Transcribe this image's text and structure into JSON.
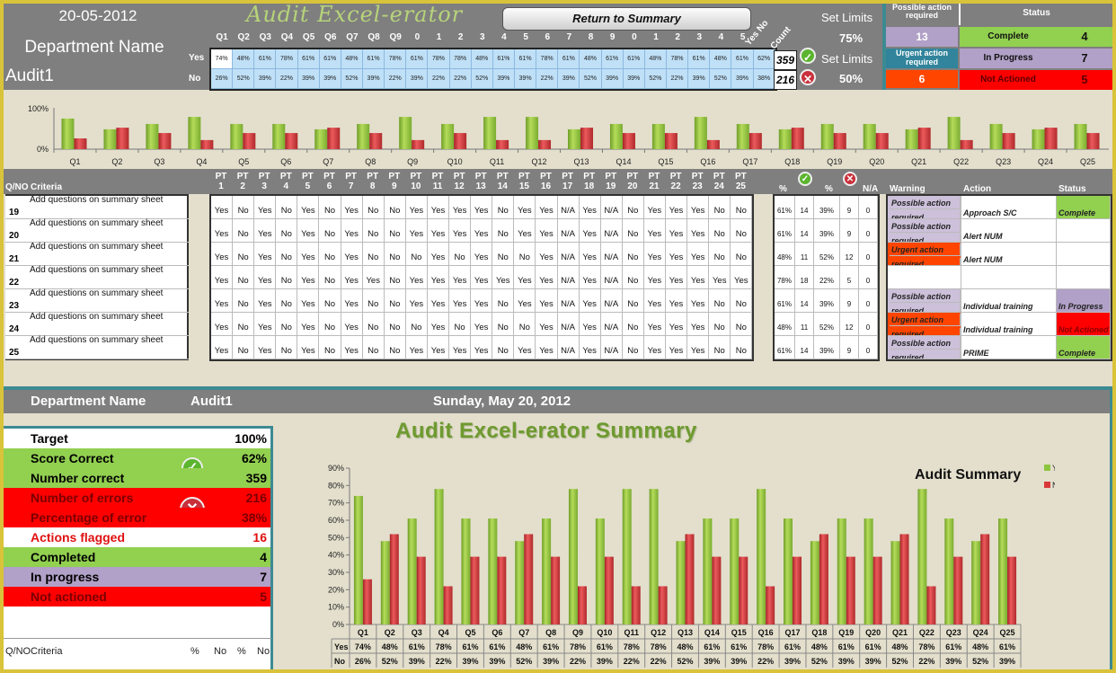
{
  "header": {
    "date": "20-05-2012",
    "department_label": "Department Name",
    "audit_name": "Audit1",
    "app_title": "Audit Excel-erator",
    "return_button": "Return to Summary",
    "row_labels": [
      "Yes",
      "No"
    ],
    "question_headers": [
      "Q1",
      "Q2",
      "Q3",
      "Q4",
      "Q5",
      "Q6",
      "Q7",
      "Q8",
      "Q9",
      "0",
      "1",
      "2",
      "3",
      "4",
      "5",
      "6",
      "7",
      "8",
      "9",
      "0",
      "1",
      "2",
      "3",
      "4",
      "5"
    ],
    "yes_no_header": "Yes No",
    "count_header": "Count",
    "yes_pcts": [
      "74%",
      "48%",
      "61%",
      "78%",
      "61%",
      "61%",
      "48%",
      "61%",
      "78%",
      "61%",
      "78%",
      "78%",
      "48%",
      "61%",
      "61%",
      "78%",
      "61%",
      "48%",
      "61%",
      "61%",
      "48%",
      "78%",
      "61%",
      "48%",
      "61%",
      "62%"
    ],
    "no_pcts": [
      "26%",
      "52%",
      "39%",
      "22%",
      "39%",
      "39%",
      "52%",
      "39%",
      "22%",
      "39%",
      "22%",
      "22%",
      "52%",
      "39%",
      "39%",
      "22%",
      "39%",
      "52%",
      "39%",
      "39%",
      "52%",
      "22%",
      "39%",
      "52%",
      "39%",
      "38%"
    ],
    "count_yes": "359",
    "count_no": "216",
    "set_limits_label": "Set Limits",
    "limit_upper": "75%",
    "limit_lower": "50%",
    "possible_action_header": "Possible action required",
    "possible_action_count": "13",
    "urgent_action_header": "Urgent action required",
    "urgent_action_count": "6",
    "status_header": "Status",
    "status": [
      {
        "label": "Complete",
        "count": "4",
        "color": "#92d050"
      },
      {
        "label": "In Progress",
        "count": "7",
        "color": "#b1a0c7"
      },
      {
        "label": "Not Actioned",
        "count": "5",
        "color": "#ff0000"
      }
    ]
  },
  "mini_chart": {
    "y_ticks": [
      "100%",
      "0%"
    ]
  },
  "detail": {
    "qno_header": "Q/NO",
    "criteria_header": "Criteria",
    "pt_headers": [
      "PT 1",
      "PT 2",
      "PT 3",
      "PT 4",
      "PT 5",
      "PT 6",
      "PT 7",
      "PT 8",
      "PT 9",
      "PT 10",
      "PT 11",
      "PT 12",
      "PT 13",
      "PT 14",
      "PT 15",
      "PT 16",
      "PT 17",
      "PT 18",
      "PT 19",
      "PT 20",
      "PT 21",
      "PT 22",
      "PT 23",
      "PT 24",
      "PT 25"
    ],
    "stat_headers": [
      "%",
      "check-icon",
      "%",
      "cross-icon",
      "N/A"
    ],
    "action_headers": [
      "Warning",
      "Action",
      "Status"
    ],
    "rows": [
      {
        "num": "19",
        "criteria": "Add  questions on summary sheet",
        "answers": [
          "Yes",
          "No",
          "Yes",
          "No",
          "Yes",
          "No",
          "Yes",
          "No",
          "No",
          "Yes",
          "Yes",
          "Yes",
          "Yes",
          "No",
          "Yes",
          "Yes",
          "N/A",
          "Yes",
          "N/A",
          "No",
          "Yes",
          "Yes",
          "Yes",
          "No",
          "No"
        ],
        "stats": [
          "61%",
          "14",
          "39%",
          "9",
          "0"
        ],
        "warning": "Possible action required",
        "warning_type": "possible",
        "action": "Approach S/C",
        "status": "Complete"
      },
      {
        "num": "20",
        "criteria": "Add  questions on summary sheet",
        "answers": [
          "Yes",
          "No",
          "Yes",
          "No",
          "Yes",
          "No",
          "Yes",
          "No",
          "No",
          "Yes",
          "Yes",
          "Yes",
          "Yes",
          "No",
          "Yes",
          "Yes",
          "N/A",
          "Yes",
          "N/A",
          "No",
          "Yes",
          "Yes",
          "Yes",
          "No",
          "No"
        ],
        "stats": [
          "61%",
          "14",
          "39%",
          "9",
          "0"
        ],
        "warning": "Possible action required",
        "warning_type": "possible",
        "action": "Alert NUM",
        "status": ""
      },
      {
        "num": "21",
        "criteria": "Add  questions on summary sheet",
        "answers": [
          "Yes",
          "No",
          "Yes",
          "No",
          "Yes",
          "No",
          "Yes",
          "No",
          "No",
          "No",
          "Yes",
          "No",
          "Yes",
          "No",
          "No",
          "Yes",
          "N/A",
          "Yes",
          "N/A",
          "No",
          "Yes",
          "Yes",
          "Yes",
          "No",
          "No"
        ],
        "stats": [
          "48%",
          "11",
          "52%",
          "12",
          "0"
        ],
        "warning": "Urgent action required",
        "warning_type": "urgent",
        "action": "Alert NUM",
        "status": ""
      },
      {
        "num": "22",
        "criteria": "Add  questions on summary sheet",
        "answers": [
          "Yes",
          "No",
          "Yes",
          "No",
          "Yes",
          "No",
          "Yes",
          "Yes",
          "No",
          "Yes",
          "Yes",
          "Yes",
          "Yes",
          "Yes",
          "Yes",
          "Yes",
          "N/A",
          "Yes",
          "N/A",
          "No",
          "Yes",
          "Yes",
          "Yes",
          "Yes",
          "Yes"
        ],
        "stats": [
          "78%",
          "18",
          "22%",
          "5",
          "0"
        ],
        "warning": "",
        "warning_type": "none",
        "action": "",
        "status": ""
      },
      {
        "num": "23",
        "criteria": "Add  questions on summary sheet",
        "answers": [
          "Yes",
          "No",
          "Yes",
          "No",
          "Yes",
          "No",
          "Yes",
          "No",
          "No",
          "Yes",
          "Yes",
          "Yes",
          "Yes",
          "No",
          "Yes",
          "Yes",
          "N/A",
          "Yes",
          "N/A",
          "No",
          "Yes",
          "Yes",
          "Yes",
          "No",
          "No"
        ],
        "stats": [
          "61%",
          "14",
          "39%",
          "9",
          "0"
        ],
        "warning": "Possible action required",
        "warning_type": "possible",
        "action": "Individual training",
        "status": "In Progress"
      },
      {
        "num": "24",
        "criteria": "Add  questions on summary sheet",
        "answers": [
          "Yes",
          "No",
          "Yes",
          "No",
          "Yes",
          "No",
          "Yes",
          "No",
          "No",
          "No",
          "Yes",
          "No",
          "Yes",
          "No",
          "No",
          "Yes",
          "N/A",
          "Yes",
          "N/A",
          "No",
          "Yes",
          "Yes",
          "Yes",
          "No",
          "No"
        ],
        "stats": [
          "48%",
          "11",
          "52%",
          "12",
          "0"
        ],
        "warning": "Urgent action required",
        "warning_type": "urgent",
        "action": "Individual training",
        "status": "Not Actioned"
      },
      {
        "num": "25",
        "criteria": "Add  questions on summary sheet",
        "answers": [
          "Yes",
          "No",
          "Yes",
          "No",
          "Yes",
          "No",
          "Yes",
          "No",
          "No",
          "Yes",
          "Yes",
          "Yes",
          "Yes",
          "No",
          "Yes",
          "Yes",
          "N/A",
          "Yes",
          "N/A",
          "No",
          "Yes",
          "Yes",
          "Yes",
          "No",
          "No"
        ],
        "stats": [
          "61%",
          "14",
          "39%",
          "9",
          "0"
        ],
        "warning": "Possible action required",
        "warning_type": "possible",
        "action": "PRIME",
        "status": "Complete"
      }
    ]
  },
  "summary": {
    "department_label": "Department Name",
    "audit_name": "Audit1",
    "date_long": "Sunday, May 20, 2012",
    "title": "Audit Excel-erator Summary",
    "kpis": [
      {
        "label": "Target",
        "value": "100%",
        "bg": "#ffffff",
        "fg": "#000000"
      },
      {
        "label": "Score Correct",
        "value": "62%",
        "bg": "#92d050",
        "fg": "#000000"
      },
      {
        "label": "Number correct",
        "value": "359",
        "bg": "#92d050",
        "fg": "#000000"
      },
      {
        "label": "Number of errors",
        "value": "216",
        "bg": "#ff0000",
        "fg": "#7a0000"
      },
      {
        "label": "Percentage of error",
        "value": "38%",
        "bg": "#ff0000",
        "fg": "#7a0000"
      },
      {
        "label": "Actions flagged",
        "value": "16",
        "bg": "#ffffff",
        "fg": "#e01010"
      },
      {
        "label": "Completed",
        "value": "4",
        "bg": "#92d050",
        "fg": "#000000"
      },
      {
        "label": "In progress",
        "value": "7",
        "bg": "#b1a0c7",
        "fg": "#000000"
      },
      {
        "label": "Not actioned",
        "value": "5",
        "bg": "#ff0000",
        "fg": "#7a0000"
      }
    ],
    "bottom_table_headers": [
      "Q/NO",
      "Criteria",
      "%",
      "No",
      "%",
      "No"
    ]
  },
  "colors": {
    "yes": "#8cc63f",
    "no": "#d9383a",
    "possible": "#ccc0da",
    "urgent": "#ff4500",
    "complete": "#92d050",
    "in_progress": "#b1a0c7",
    "not_actioned": "#ff0000"
  },
  "chart_data": [
    {
      "type": "bar",
      "title": "",
      "categories": [
        "Q1",
        "Q2",
        "Q3",
        "Q4",
        "Q5",
        "Q6",
        "Q7",
        "Q8",
        "Q9",
        "Q10",
        "Q11",
        "Q12",
        "Q13",
        "Q14",
        "Q15",
        "Q16",
        "Q17",
        "Q18",
        "Q19",
        "Q20",
        "Q21",
        "Q22",
        "Q23",
        "Q24",
        "Q25"
      ],
      "series": [
        {
          "name": "Yes",
          "values": [
            74,
            48,
            61,
            78,
            61,
            61,
            48,
            61,
            78,
            61,
            78,
            78,
            48,
            61,
            61,
            78,
            61,
            48,
            61,
            61,
            48,
            78,
            61,
            48,
            61
          ]
        },
        {
          "name": "No",
          "values": [
            26,
            52,
            39,
            22,
            39,
            39,
            52,
            39,
            22,
            39,
            22,
            22,
            52,
            39,
            39,
            22,
            39,
            52,
            39,
            39,
            52,
            22,
            39,
            52,
            39
          ]
        }
      ],
      "ylim": [
        0,
        100
      ],
      "y_ticks": [
        "0%",
        "100%"
      ],
      "legend": "none"
    },
    {
      "type": "bar",
      "title": "Audit Summary",
      "categories": [
        "Q1",
        "Q2",
        "Q3",
        "Q4",
        "Q5",
        "Q6",
        "Q7",
        "Q8",
        "Q9",
        "Q10",
        "Q11",
        "Q12",
        "Q13",
        "Q14",
        "Q15",
        "Q16",
        "Q17",
        "Q18",
        "Q19",
        "Q20",
        "Q21",
        "Q22",
        "Q23",
        "Q24",
        "Q25"
      ],
      "series": [
        {
          "name": "Yes",
          "values": [
            74,
            48,
            61,
            78,
            61,
            61,
            48,
            61,
            78,
            61,
            78,
            78,
            48,
            61,
            61,
            78,
            61,
            48,
            61,
            61,
            48,
            78,
            61,
            48,
            61
          ],
          "labels": [
            "74%",
            "48%",
            "61%",
            "78%",
            "61%",
            "61%",
            "48%",
            "61%",
            "78%",
            "61%",
            "78%",
            "78%",
            "48%",
            "61%",
            "61%",
            "78%",
            "61%",
            "48%",
            "61%",
            "61%",
            "48%",
            "78%",
            "61%",
            "48%",
            "61%"
          ]
        },
        {
          "name": "No",
          "values": [
            26,
            52,
            39,
            22,
            39,
            39,
            52,
            39,
            22,
            39,
            22,
            22,
            52,
            39,
            39,
            22,
            39,
            52,
            39,
            39,
            52,
            22,
            39,
            52,
            39
          ],
          "labels": [
            "26%",
            "52%",
            "39%",
            "22%",
            "39%",
            "39%",
            "52%",
            "39%",
            "22%",
            "39%",
            "22%",
            "22%",
            "52%",
            "39%",
            "39%",
            "22%",
            "39%",
            "52%",
            "39%",
            "39%",
            "52%",
            "22%",
            "39%",
            "52%",
            "39%"
          ]
        }
      ],
      "ylim": [
        0,
        90
      ],
      "y_ticks": [
        "0%",
        "10%",
        "20%",
        "30%",
        "40%",
        "50%",
        "60%",
        "70%",
        "80%",
        "90%"
      ],
      "data_table": true,
      "legend": "top-right"
    }
  ]
}
